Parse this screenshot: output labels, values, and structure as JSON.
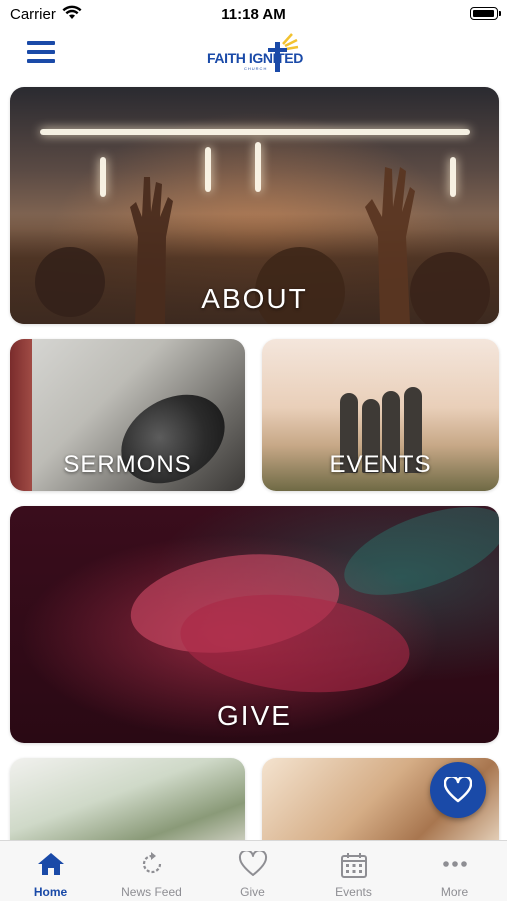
{
  "status_bar": {
    "carrier": "Carrier",
    "time": "11:18 AM"
  },
  "header": {
    "logo_text": "FAITH IGNITED",
    "logo_subtext": "CHURCH",
    "menu_icon": "hamburger-icon"
  },
  "tiles": [
    {
      "label": "ABOUT"
    },
    {
      "label": "SERMONS"
    },
    {
      "label": "EVENTS"
    },
    {
      "label": "GIVE"
    }
  ],
  "fab": {
    "icon": "heart-icon"
  },
  "tab_bar": {
    "active": "Home",
    "items": [
      {
        "label": "Home",
        "icon": "home-icon"
      },
      {
        "label": "News Feed",
        "icon": "refresh-icon"
      },
      {
        "label": "Give",
        "icon": "heart-icon"
      },
      {
        "label": "Events",
        "icon": "calendar-icon"
      },
      {
        "label": "More",
        "icon": "more-dots-icon"
      }
    ]
  },
  "colors": {
    "brand_blue": "#1a4aa8",
    "inactive_gray": "#8e8e93",
    "logo_yellow": "#f2c230"
  }
}
